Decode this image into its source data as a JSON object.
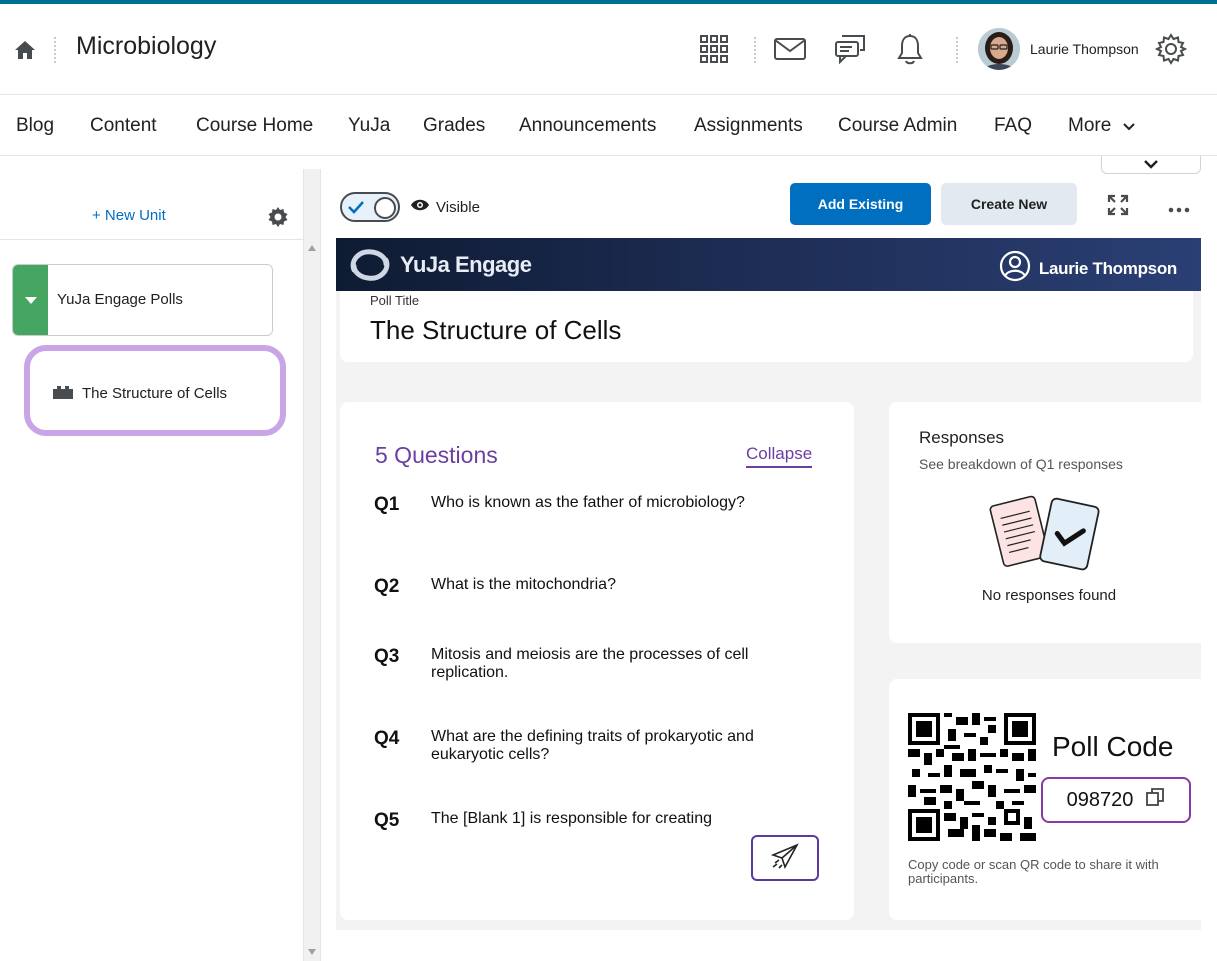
{
  "header": {
    "course_title": "Microbiology",
    "user_name": "Laurie Thompson"
  },
  "nav": {
    "items": [
      "Blog",
      "Content",
      "Course Home",
      "YuJa",
      "Grades",
      "Announcements",
      "Assignments",
      "Course Admin",
      "FAQ"
    ],
    "more_label": "More"
  },
  "left_panel": {
    "new_unit_label": "+ New Unit",
    "unit_title": "YuJa Engage Polls",
    "selected_item": "The Structure of Cells"
  },
  "toolbar": {
    "visibility_label": "Visible",
    "add_existing_label": "Add Existing",
    "create_new_label": "Create New"
  },
  "yuja": {
    "brand": "YuJa Engage",
    "user_name": "Laurie Thompson",
    "poll_title_label": "Poll Title",
    "poll_title": "The Structure of Cells",
    "questions_heading": "5 Questions",
    "collapse_label": "Collapse",
    "questions": [
      {
        "num": "Q1",
        "text": "Who is known as the father of microbiology?"
      },
      {
        "num": "Q2",
        "text": "What is the mitochondria?"
      },
      {
        "num": "Q3",
        "text": "Mitosis and meiosis are the processes of cell replication."
      },
      {
        "num": "Q4",
        "text": "What are the defining traits of prokaryotic and eukaryotic cells?"
      },
      {
        "num": "Q5",
        "text": "The [Blank 1] is responsible for creating"
      }
    ],
    "responses_title": "Responses",
    "responses_subtitle": "See breakdown of Q1 responses",
    "responses_empty": "No responses found",
    "poll_code_title": "Poll Code",
    "poll_code": "098720",
    "poll_code_help": "Copy code or scan QR code to share it with participants."
  },
  "colors": {
    "accent_blue": "#006fbf",
    "unit_green": "#46a661",
    "highlight_purple": "#c9a4e6",
    "yuja_purple": "#6a3fa0"
  }
}
